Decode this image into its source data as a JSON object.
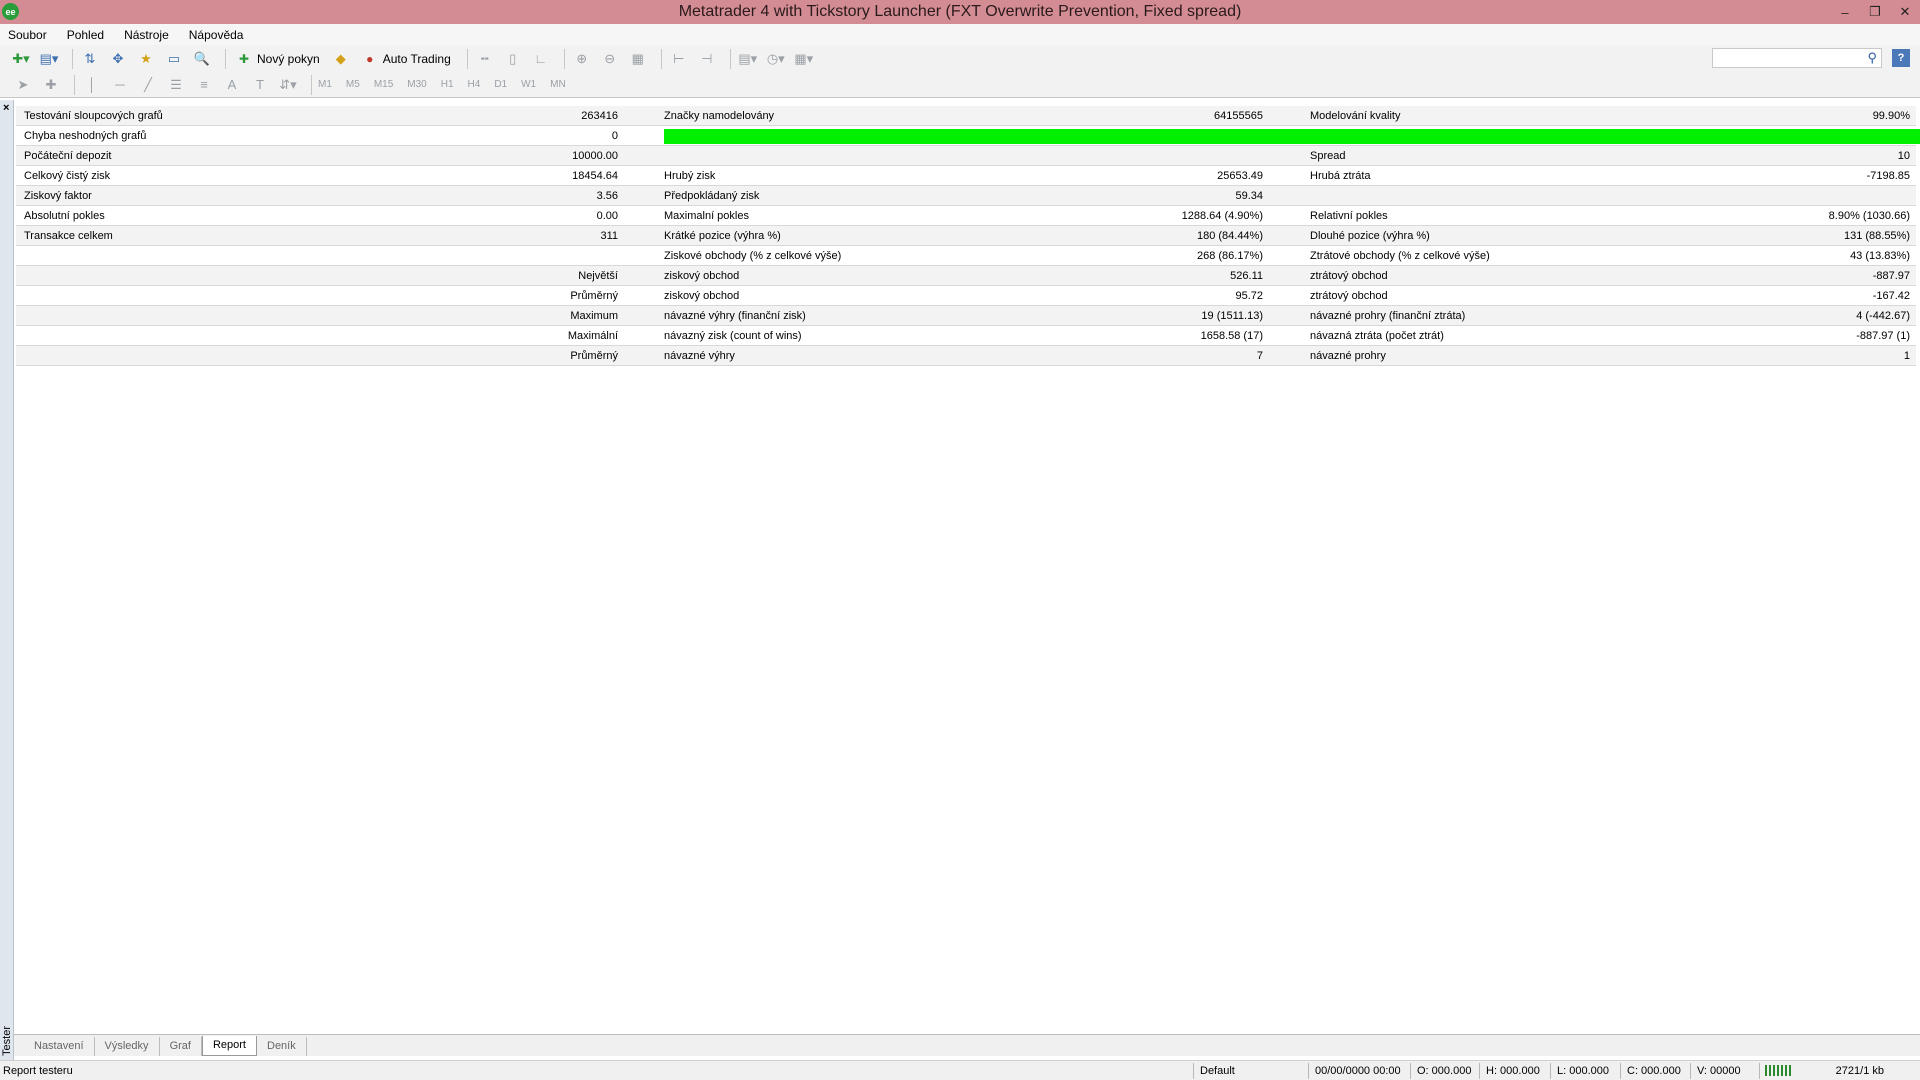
{
  "window": {
    "title": "Metatrader 4 with Tickstory Launcher (FXT Overwrite Prevention, Fixed spread)",
    "icon": "mt4-icon"
  },
  "menu": {
    "items": [
      {
        "label": "Soubor"
      },
      {
        "label": "Pohled"
      },
      {
        "label": "Nástroje"
      },
      {
        "label": "Nápověda"
      }
    ]
  },
  "toolbar": {
    "new_order_label": "Nový pokyn",
    "auto_trading_label": "Auto Trading"
  },
  "timeframes": [
    "M1",
    "M5",
    "M15",
    "M30",
    "H1",
    "H4",
    "D1",
    "W1",
    "MN"
  ],
  "report": {
    "rows": [
      {
        "c1": "Testování sloupcových grafů",
        "c2": "263416",
        "c3": "Značky namodelovány",
        "c4": "64155565",
        "c5": "Modelování kvality",
        "c6": "99.90%"
      },
      {
        "c1": "Chyba neshodných grafů",
        "c2": "0",
        "quality_fraction": 0.999
      },
      {
        "c1": "Počáteční depozit",
        "c2": "10000.00",
        "c3": "",
        "c4": "",
        "c5": "Spread",
        "c6": "10"
      },
      {
        "c1": "Celkový čistý zisk",
        "c2": "18454.64",
        "c3": "Hrubý zisk",
        "c4": "25653.49",
        "c5": "Hrubá ztráta",
        "c6": "-7198.85"
      },
      {
        "c1": "Ziskový faktor",
        "c2": "3.56",
        "c3": "Předpokládaný zisk",
        "c4": "59.34",
        "c5": "",
        "c6": ""
      },
      {
        "c1": "Absolutní pokles",
        "c2": "0.00",
        "c3": "Maximalní pokles",
        "c4": "1288.64 (4.90%)",
        "c5": "Relativní pokles",
        "c6": "8.90% (1030.66)"
      },
      {
        "c1": "Transakce celkem",
        "c2": "311",
        "c3": "Krátké pozice (výhra %)",
        "c4": "180 (84.44%)",
        "c5": "Dlouhé pozice (výhra %)",
        "c6": "131 (88.55%)"
      },
      {
        "c1": "",
        "c2": "",
        "c3": "Ziskové obchody (% z celkové výše)",
        "c4": "268 (86.17%)",
        "c5": "Ztrátové obchody (% z celkové výše)",
        "c6": "43 (13.83%)"
      },
      {
        "c1r": "Největší",
        "c3": "ziskový obchod",
        "c4": "526.11",
        "c5": "ztrátový obchod",
        "c6": "-887.97"
      },
      {
        "c1r": "Průměrný",
        "c3": "ziskový obchod",
        "c4": "95.72",
        "c5": "ztrátový obchod",
        "c6": "-167.42"
      },
      {
        "c1r": "Maximum",
        "c3": "návazné výhry (finanční zisk)",
        "c4": "19 (1511.13)",
        "c5": "návazné prohry (finanční ztráta)",
        "c6": "4 (-442.67)"
      },
      {
        "c1r": "Maximální",
        "c3": "návazný zisk (count of wins)",
        "c4": "1658.58 (17)",
        "c5": "návazná ztráta (počet ztrát)",
        "c6": "-887.97 (1)"
      },
      {
        "c1r": "Průměrný",
        "c3": "návazné výhry",
        "c4": "7",
        "c5": "návazné prohry",
        "c6": "1"
      }
    ]
  },
  "tester": {
    "side_label": "Tester",
    "tabs": [
      {
        "label": "Nastavení"
      },
      {
        "label": "Výsledky"
      },
      {
        "label": "Graf"
      },
      {
        "label": "Report",
        "active": true
      },
      {
        "label": "Deník"
      }
    ]
  },
  "status": {
    "left": "Report testeru",
    "profile": "Default",
    "datetime": "00/00/0000 00:00",
    "open": "O: 000.000",
    "high": "H: 000.000",
    "low": "L: 000.000",
    "close": "C: 000.000",
    "volume": "V: 00000",
    "traffic": "2721/1 kb"
  },
  "colors": {
    "titlebar": "#d38c93",
    "quality_bar": "#00f000"
  }
}
